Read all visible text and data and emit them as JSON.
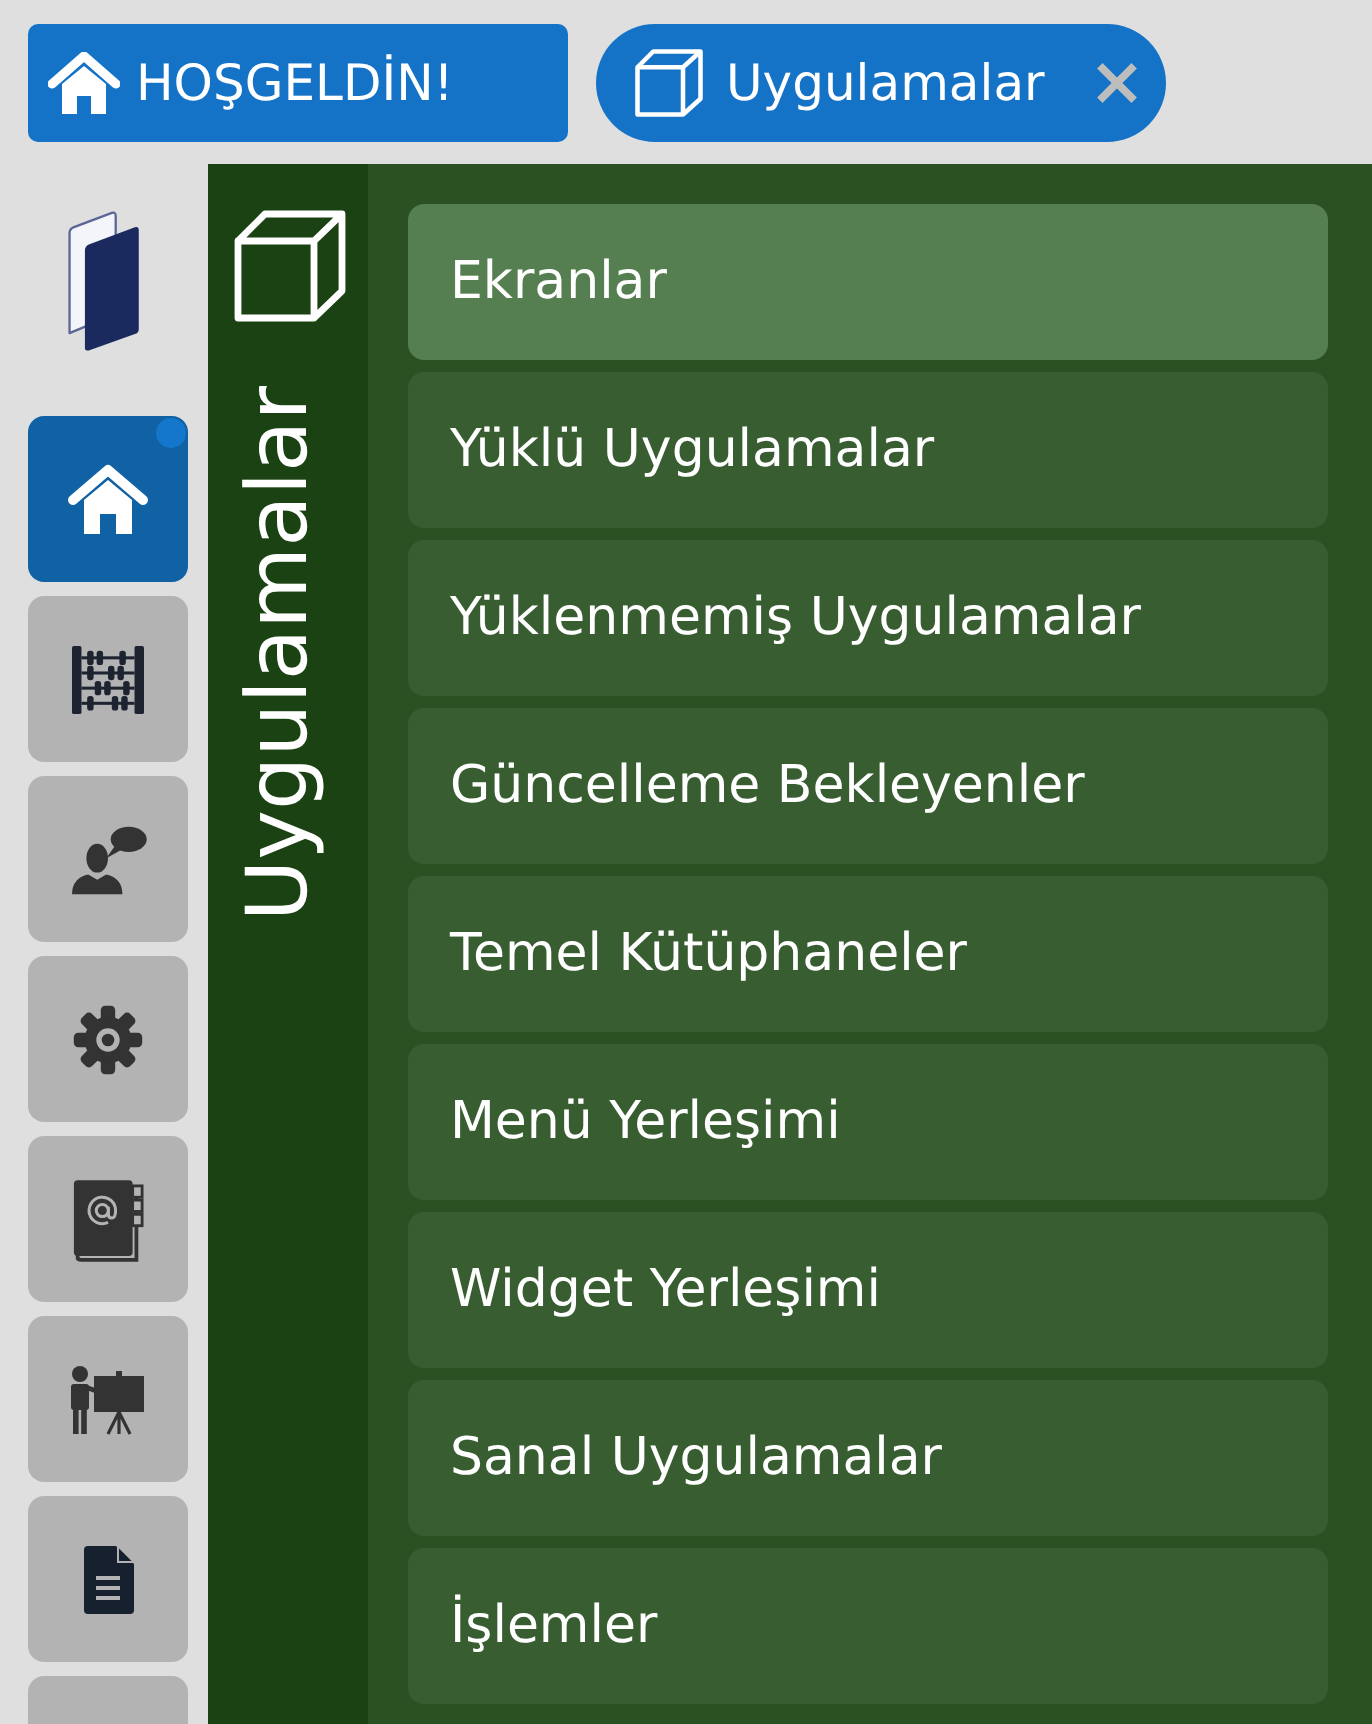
{
  "top_bar": {
    "welcome_button": {
      "label": "HOŞGELDİN!"
    },
    "tabs": [
      {
        "label": "Uygulamalar",
        "selected": true
      }
    ]
  },
  "sidebar": {
    "items": [
      {
        "kind": "home",
        "selected": true,
        "notification": true
      },
      {
        "kind": "abacus",
        "selected": false,
        "notification": false
      },
      {
        "kind": "person_speech",
        "selected": false,
        "notification": false
      },
      {
        "kind": "gear",
        "selected": false,
        "notification": false
      },
      {
        "kind": "address_book",
        "selected": false,
        "notification": false
      },
      {
        "kind": "presenter",
        "selected": false,
        "notification": false
      },
      {
        "kind": "document",
        "selected": false,
        "notification": false
      },
      {
        "kind": "cut_off",
        "selected": false,
        "notification": false
      }
    ]
  },
  "panel": {
    "title": "Uygulamalar",
    "items": [
      {
        "label": "Ekranlar",
        "selected": true
      },
      {
        "label": "Yüklü Uygulamalar",
        "selected": false
      },
      {
        "label": "Yüklenmemiş Uygulamalar",
        "selected": false
      },
      {
        "label": "Güncelleme Bekleyenler",
        "selected": false
      },
      {
        "label": "Temel Kütüphaneler",
        "selected": false
      },
      {
        "label": "Menü Yerleşimi",
        "selected": false
      },
      {
        "label": "Widget Yerleşimi",
        "selected": false
      },
      {
        "label": "Sanal Uygulamalar",
        "selected": false
      },
      {
        "label": "İşlemler",
        "selected": false
      }
    ]
  }
}
